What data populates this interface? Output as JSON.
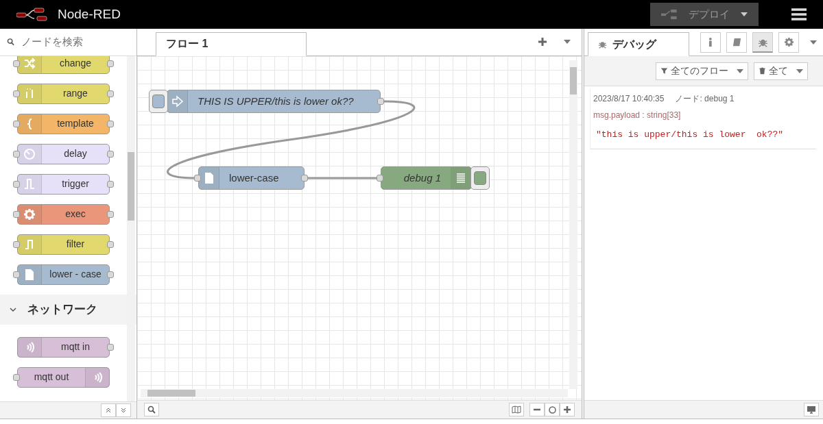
{
  "header": {
    "title": "Node-RED",
    "deploy": {
      "label": "デプロイ",
      "disabled": true
    }
  },
  "palette": {
    "search": {
      "placeholder": "ノードを検索"
    },
    "items": [
      {
        "kind": "node",
        "label": "change",
        "color": "#e2d96e"
      },
      {
        "kind": "node",
        "label": "range",
        "color": "#e2d96e"
      },
      {
        "kind": "node",
        "label": "template",
        "color": "#f3b567"
      },
      {
        "kind": "node",
        "label": "delay",
        "color": "#e6e0f8"
      },
      {
        "kind": "node",
        "label": "trigger",
        "color": "#e6e0f8"
      },
      {
        "kind": "node",
        "label": "exec",
        "color": "#e9967a"
      },
      {
        "kind": "node",
        "label": "filter",
        "color": "#e2d96e"
      },
      {
        "kind": "node",
        "label": "lower - case",
        "color": "#a6bbcf"
      },
      {
        "kind": "category",
        "label": "ネットワーク",
        "expanded": true
      },
      {
        "kind": "source",
        "label": "mqtt in",
        "color": "#d8bfd8"
      },
      {
        "kind": "sink",
        "label": "mqtt out",
        "color": "#d8bfd8"
      }
    ]
  },
  "workspace": {
    "tabs": [
      {
        "label": "フロー 1",
        "selected": true
      }
    ],
    "nodes": [
      {
        "kind": "inject",
        "label": "THIS IS UPPER/this is lower ok??",
        "italic": true,
        "color": "#a6bbcf"
      },
      {
        "kind": "function",
        "label": "lower-case",
        "italic": false,
        "color": "#a6bbcf"
      },
      {
        "kind": "debug",
        "label": "debug 1",
        "italic": true,
        "color": "#87a980",
        "active": true
      }
    ]
  },
  "sidebar": {
    "tabs": [
      {
        "label": "デバッグ",
        "selected": true
      }
    ],
    "tab_buttons": [
      {
        "selected": false
      },
      {
        "selected": false
      },
      {
        "selected": true
      },
      {
        "selected": false
      }
    ],
    "filters": [
      {
        "label": "全てのフロー"
      },
      {
        "label": "全て"
      }
    ],
    "messages": [
      {
        "time": "2023/8/17 10:40:35",
        "node": "ノード: debug 1",
        "property": "msg.payload : string[33]",
        "value": "\"this is upper/this is lower  ok??\""
      }
    ]
  }
}
